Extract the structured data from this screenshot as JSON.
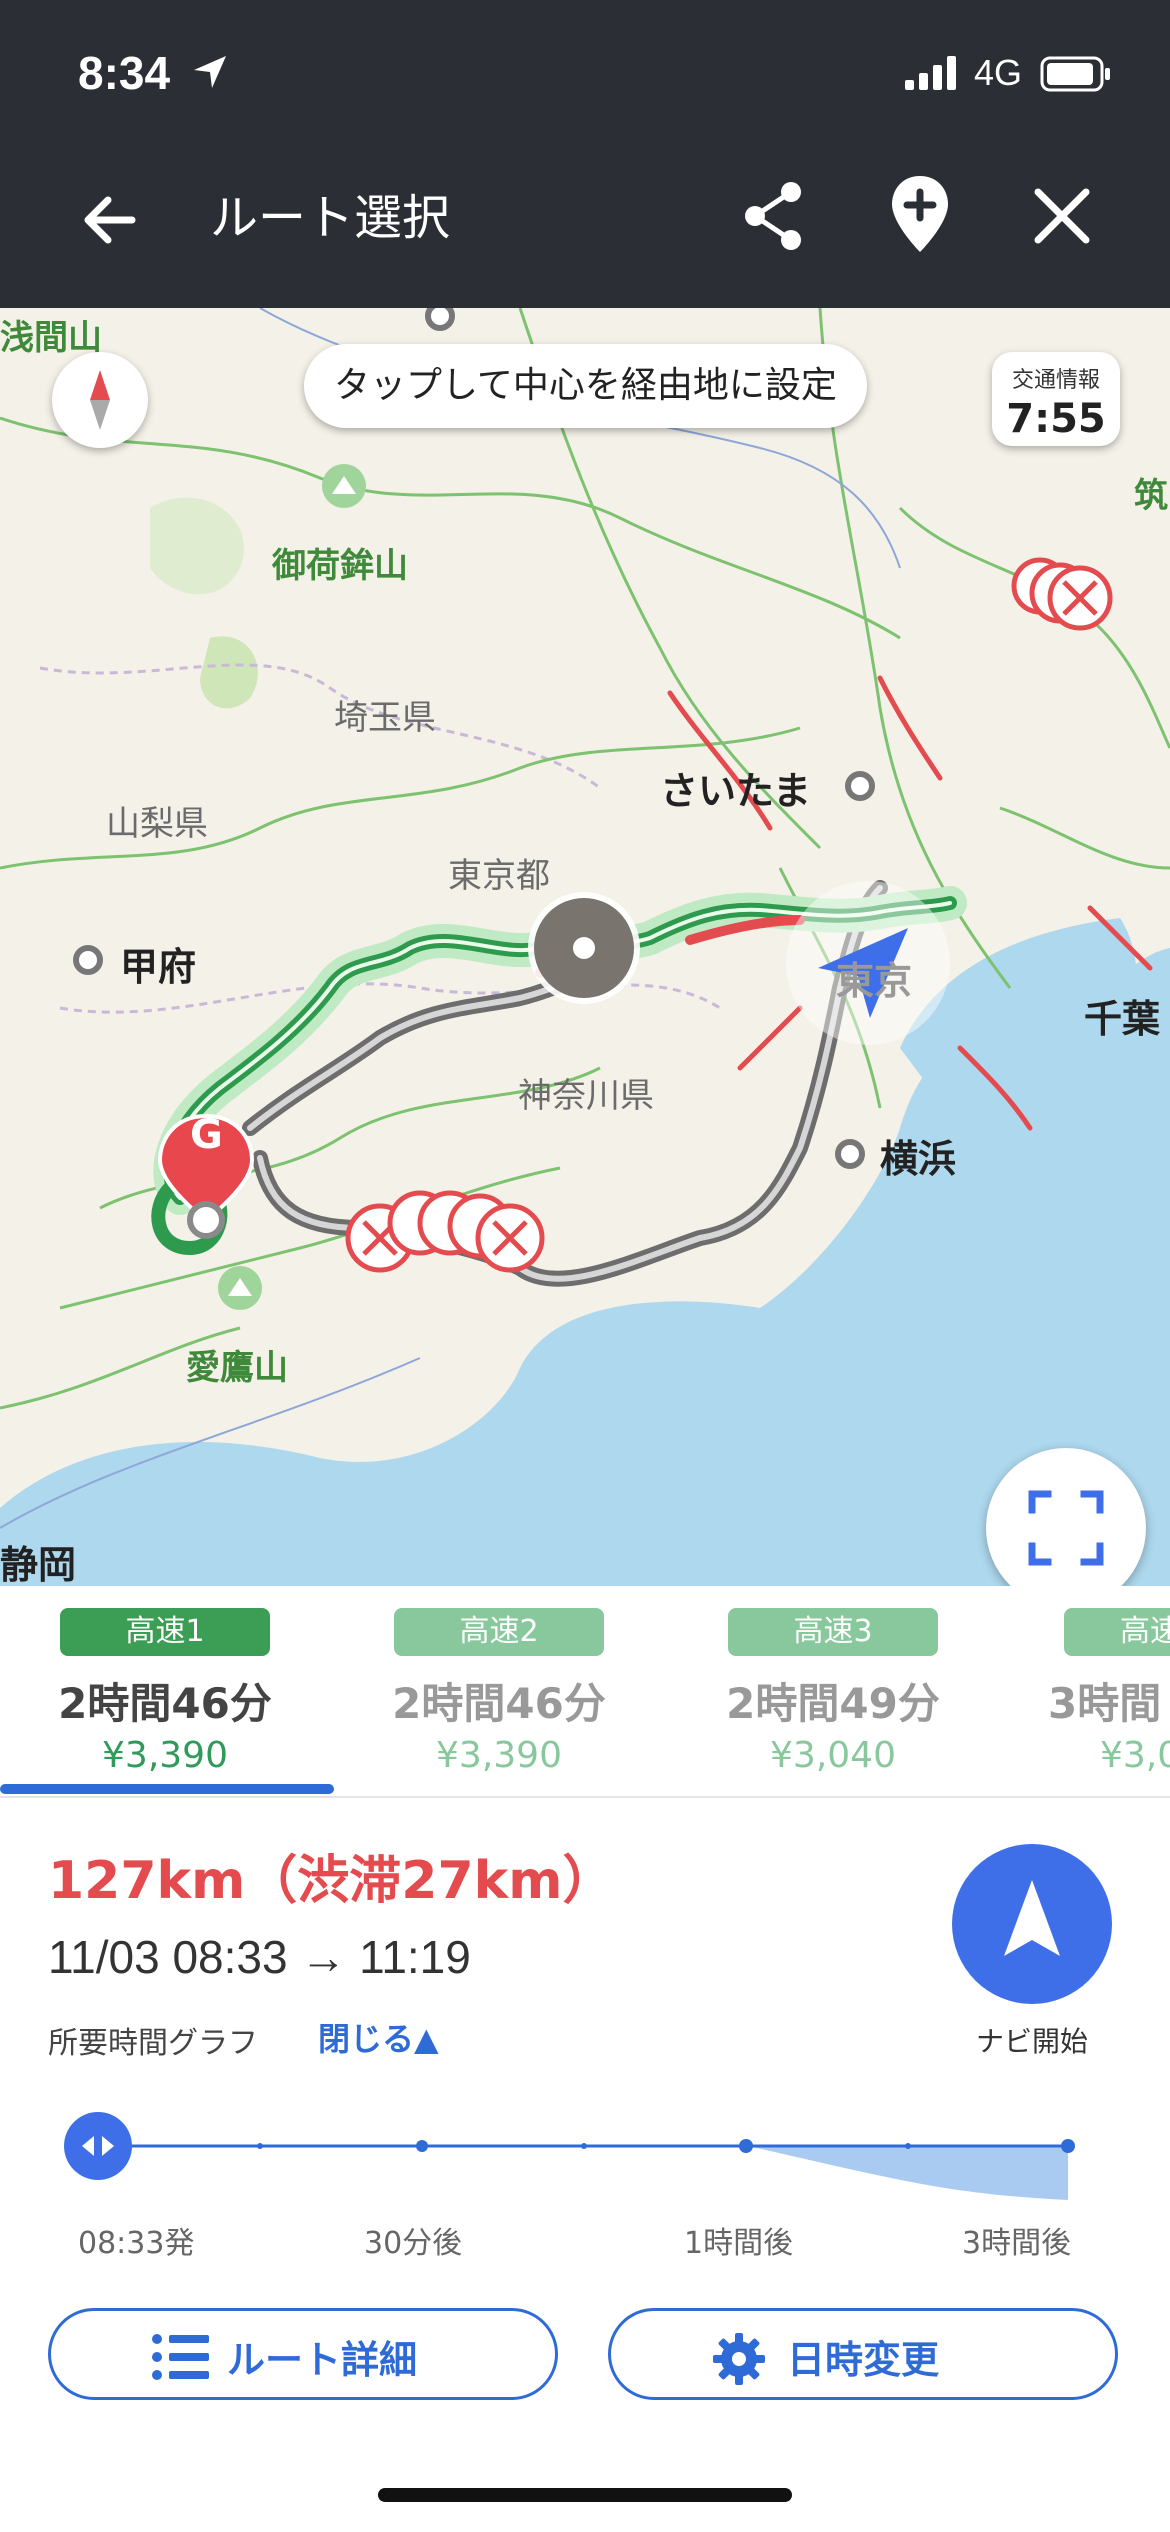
{
  "status": {
    "time": "8:34",
    "network": "4G"
  },
  "header": {
    "title": "ルート選択"
  },
  "map": {
    "hint_pill": "タップして中心を経由地に設定",
    "traffic_info": {
      "label": "交通情報",
      "time": "7:55"
    },
    "labels": {
      "asama": "浅間山",
      "okazan": "御荷鉾山",
      "saitama_pref": "埼玉県",
      "yamanashi_pref": "山梨県",
      "saitama_city": "さいたま",
      "tokyo_to": "東京都",
      "kofu": "甲府",
      "tokyo": "東京",
      "chiba": "千葉",
      "kanagawa_pref": "神奈川県",
      "yokohama": "横浜",
      "aitaka": "愛鷹山",
      "shizuoka": "静岡",
      "tsuku": "筑"
    },
    "goal_marker": "G"
  },
  "routes": [
    {
      "badge": "高速1",
      "duration": "2時間46分",
      "price": "¥3,390"
    },
    {
      "badge": "高速2",
      "duration": "2時間46分",
      "price": "¥3,390"
    },
    {
      "badge": "高速3",
      "duration": "2時間49分",
      "price": "¥3,040"
    },
    {
      "badge": "高速",
      "duration": "3時間",
      "price": "¥3,0"
    }
  ],
  "summary": {
    "distance": "127km（渋滞27km）",
    "time_range": "11/03  08:33 → 11:19",
    "graph_label": "所要時間グラフ",
    "graph_toggle": "閉じる▲",
    "nav_start_label": "ナビ開始",
    "graph_ticks": [
      "08:33発",
      "30分後",
      "1時間後",
      "3時間後"
    ]
  },
  "buttons": {
    "route_detail": "ルート詳細",
    "change_datetime": "日時変更"
  },
  "colors": {
    "accent": "#2f6bd6",
    "congestion": "#e34b4f",
    "route_active": "#3fa35a",
    "route_alt": "#88c89c"
  }
}
